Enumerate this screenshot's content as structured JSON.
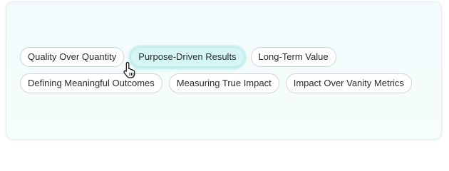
{
  "tags": {
    "row1": [
      {
        "label": "Quality Over Quantity"
      },
      {
        "label": "Purpose-Driven Results"
      },
      {
        "label": "Long-Term Value"
      }
    ],
    "row2": [
      {
        "label": "Defining Meaningful Outcomes"
      },
      {
        "label": "Measuring True Impact"
      },
      {
        "label": "Impact Over Vanity Metrics"
      }
    ]
  },
  "colors": {
    "active_tag_bg": "#d6f5f5",
    "card_bg": "#f1fbfb",
    "tag_border": "#cfd5d5"
  },
  "icons": {
    "cursor": "hand-pointer-icon"
  }
}
